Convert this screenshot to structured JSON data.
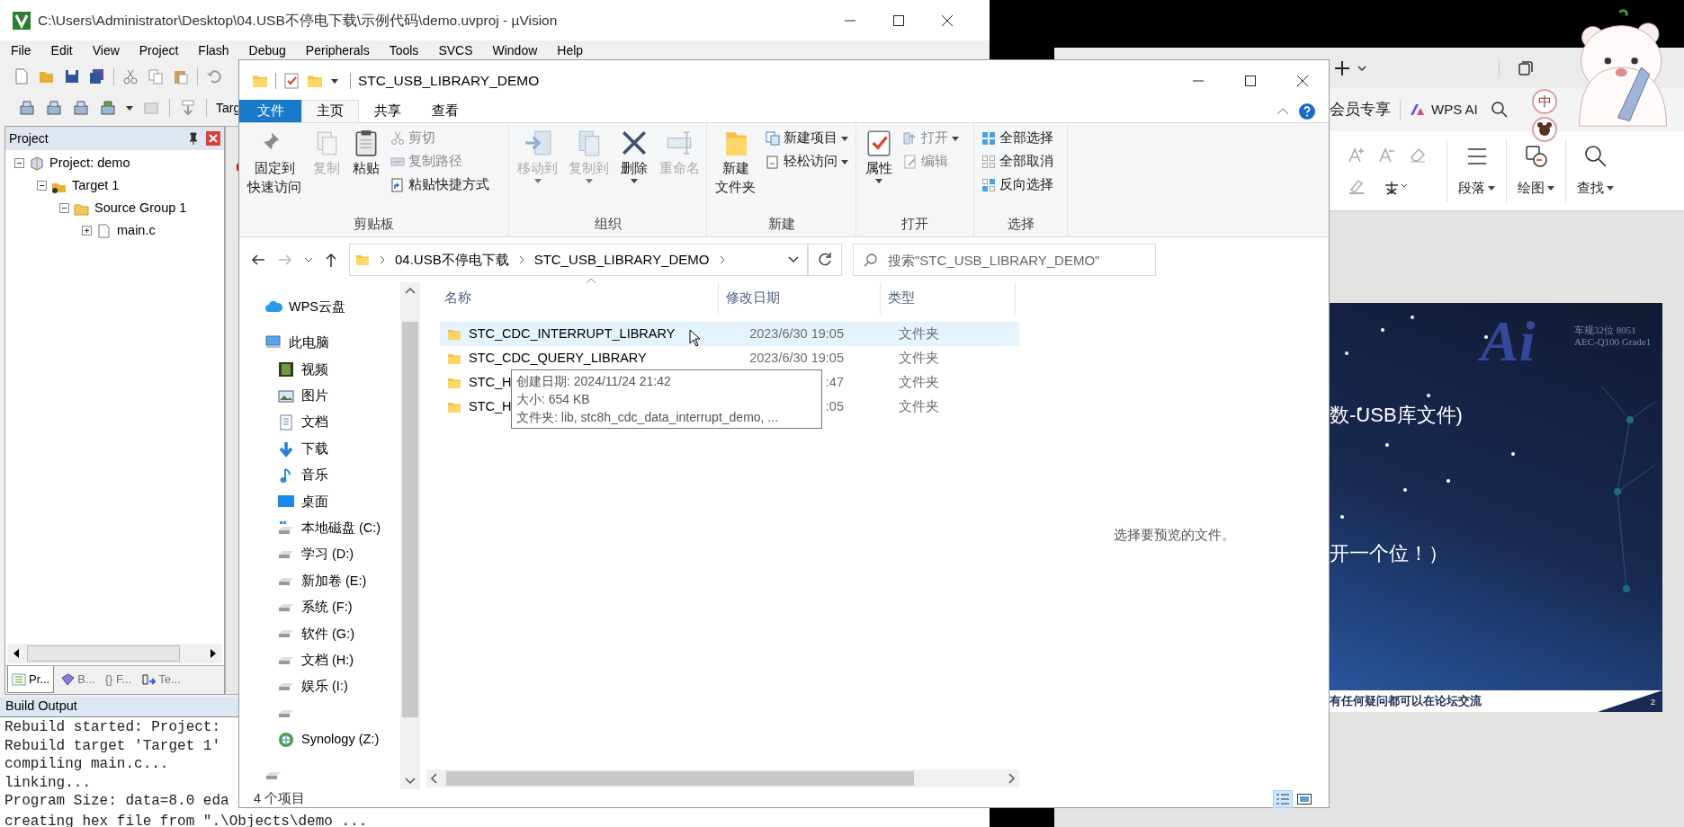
{
  "uvision": {
    "title": "C:\\Users\\Administrator\\Desktop\\04.USB不停电下载\\示例代码\\demo.uvproj - µVision",
    "menu": [
      "File",
      "Edit",
      "View",
      "Project",
      "Flash",
      "Debug",
      "Peripherals",
      "Tools",
      "SVCS",
      "Window",
      "Help"
    ],
    "toolbar_text": "Targ",
    "project_panel": {
      "title": "Project",
      "tree": [
        {
          "label": "Project: demo",
          "kind": "project",
          "expanded": true,
          "children": [
            {
              "label": "Target 1",
              "kind": "target",
              "expanded": true,
              "children": [
                {
                  "label": "Source Group 1",
                  "kind": "group",
                  "expanded": true,
                  "children": [
                    {
                      "label": "main.c",
                      "kind": "file",
                      "expanded": false
                    }
                  ]
                }
              ]
            }
          ]
        }
      ]
    },
    "panel_tabs": [
      {
        "label": "Pr...",
        "kind": "project",
        "selected": true
      },
      {
        "label": "B...",
        "kind": "books",
        "selected": false
      },
      {
        "label": "F...",
        "kind": "functions",
        "symbol": "{}",
        "selected": false
      },
      {
        "label": "Te...",
        "kind": "templates",
        "selected": false
      }
    ],
    "build_output": {
      "title": "Build Output",
      "lines": [
        "Rebuild started: Project:",
        "Rebuild target 'Target 1'",
        "compiling main.c...",
        "linking...",
        "Program Size: data=8.0 eda",
        "creating hex file from \".\\Objects\\demo ..."
      ]
    }
  },
  "explorer": {
    "title": "STC_USB_LIBRARY_DEMO",
    "ribbon_tabs": [
      {
        "label": "文件",
        "kind": "file",
        "selected": false
      },
      {
        "label": "主页",
        "kind": "tab",
        "selected": true
      },
      {
        "label": "共享",
        "kind": "tab",
        "selected": false
      },
      {
        "label": "查看",
        "kind": "tab",
        "selected": false
      }
    ],
    "ribbon_groups": [
      {
        "label": "剪贴板",
        "items": [
          {
            "kind": "large",
            "label_lines": [
              "固定到",
              "快速访问"
            ],
            "disabled": false,
            "dropdown": false
          },
          {
            "kind": "large",
            "label_lines": [
              "复制"
            ],
            "disabled": true,
            "dropdown": false
          },
          {
            "kind": "large",
            "label_lines": [
              "粘贴"
            ],
            "disabled": false,
            "dropdown": false
          },
          {
            "kind": "stack",
            "items": [
              {
                "label": "剪切",
                "disabled": true,
                "dropdown": false
              },
              {
                "label": "复制路径",
                "disabled": true,
                "dropdown": false
              },
              {
                "label": "粘贴快捷方式",
                "disabled": false,
                "dropdown": false
              }
            ]
          }
        ]
      },
      {
        "label": "组织",
        "items": [
          {
            "kind": "large",
            "label_lines": [
              "移动到"
            ],
            "disabled": true,
            "dropdown": true
          },
          {
            "kind": "large",
            "label_lines": [
              "复制到"
            ],
            "disabled": true,
            "dropdown": true
          },
          {
            "kind": "large",
            "label_lines": [
              "删除"
            ],
            "disabled": false,
            "dropdown": true
          },
          {
            "kind": "large",
            "label_lines": [
              "重命名"
            ],
            "disabled": true,
            "dropdown": false
          }
        ]
      },
      {
        "label": "新建",
        "items": [
          {
            "kind": "large",
            "label_lines": [
              "新建",
              "文件夹"
            ],
            "disabled": false,
            "dropdown": false
          },
          {
            "kind": "stack",
            "items": [
              {
                "label": "新建项目",
                "disabled": false,
                "dropdown": true
              },
              {
                "label": "轻松访问",
                "disabled": false,
                "dropdown": true
              }
            ]
          }
        ]
      },
      {
        "label": "打开",
        "items": [
          {
            "kind": "large",
            "label_lines": [
              "属性"
            ],
            "disabled": false,
            "dropdown": true
          },
          {
            "kind": "stack",
            "items": [
              {
                "label": "打开",
                "disabled": true,
                "dropdown": true
              },
              {
                "label": "编辑",
                "disabled": true,
                "dropdown": false
              }
            ]
          }
        ]
      },
      {
        "label": "选择",
        "items": [
          {
            "kind": "stack",
            "items": [
              {
                "label": "全部选择",
                "disabled": false,
                "dropdown": false
              },
              {
                "label": "全部取消",
                "disabled": false,
                "dropdown": false
              },
              {
                "label": "反向选择",
                "disabled": false,
                "dropdown": false
              }
            ]
          }
        ]
      }
    ],
    "address": {
      "segments": [
        "04.USB不停电下载",
        "STC_USB_LIBRARY_DEMO"
      ]
    },
    "search": {
      "placeholder": "搜索\"STC_USB_LIBRARY_DEMO\""
    },
    "nav_items": [
      {
        "label": "WPS云盘",
        "kind": "cloud"
      },
      {
        "label": "此电脑",
        "kind": "pc",
        "children": [
          {
            "label": "视频",
            "kind": "video"
          },
          {
            "label": "图片",
            "kind": "pictures"
          },
          {
            "label": "文档",
            "kind": "documents"
          },
          {
            "label": "下载",
            "kind": "download"
          },
          {
            "label": "音乐",
            "kind": "music"
          },
          {
            "label": "桌面",
            "kind": "desktop"
          },
          {
            "label": "本地磁盘 (C:)",
            "kind": "system_drive"
          },
          {
            "label": "学习 (D:)",
            "kind": "drive"
          },
          {
            "label": "新加卷 (E:)",
            "kind": "drive"
          },
          {
            "label": "系统 (F:)",
            "kind": "drive"
          },
          {
            "label": "软件 (G:)",
            "kind": "drive"
          },
          {
            "label": "文档 (H:)",
            "kind": "drive"
          },
          {
            "label": "娱乐 (I:)",
            "kind": "drive"
          },
          {
            "kind": "drive"
          },
          {
            "label": "Synology (Z:)",
            "kind": "network"
          }
        ]
      },
      {
        "kind": "drive"
      }
    ],
    "columns": [
      "名称",
      "修改日期",
      "类型"
    ],
    "files": [
      {
        "name": "STC_CDC_INTERRUPT_LIBRARY",
        "date": "2023/6/30 19:05",
        "type": "文件夹",
        "selected": true
      },
      {
        "name": "STC_CDC_QUERY_LIBRARY",
        "date": "2023/6/30 19:05",
        "type": "文件夹",
        "selected": false
      },
      {
        "name": "STC_H",
        "date": ":47",
        "type": "文件夹",
        "selected": false
      },
      {
        "name": "STC_H",
        "date": ":05",
        "type": "文件夹",
        "selected": false
      }
    ],
    "tooltip": [
      "创建日期: 2024/11/24 21:42",
      "大小: 654 KB",
      "文件夹: lib, stc8h_cdc_data_interrupt_demo, ..."
    ],
    "preview_text": "选择要预览的文件。",
    "status": "4 个项目",
    "view_buttons": [
      {
        "kind": "details",
        "selected": true
      },
      {
        "kind": "large_icons",
        "selected": false
      }
    ]
  },
  "wps": {
    "vip_label": "会员专享",
    "ai_button": "WPS AI",
    "ribbon_labels": [
      "段落",
      "绘图",
      "查找"
    ],
    "slide": {
      "lines": [
        "数-USB库文件)",
        "开一个位！）"
      ],
      "logo": "Ai",
      "logo_caption": [
        "车规32位 8051",
        "AEC-Q100 Grade1"
      ],
      "footer": "有任何疑问都可以在论坛交流",
      "page": "2"
    }
  },
  "ime": "中"
}
